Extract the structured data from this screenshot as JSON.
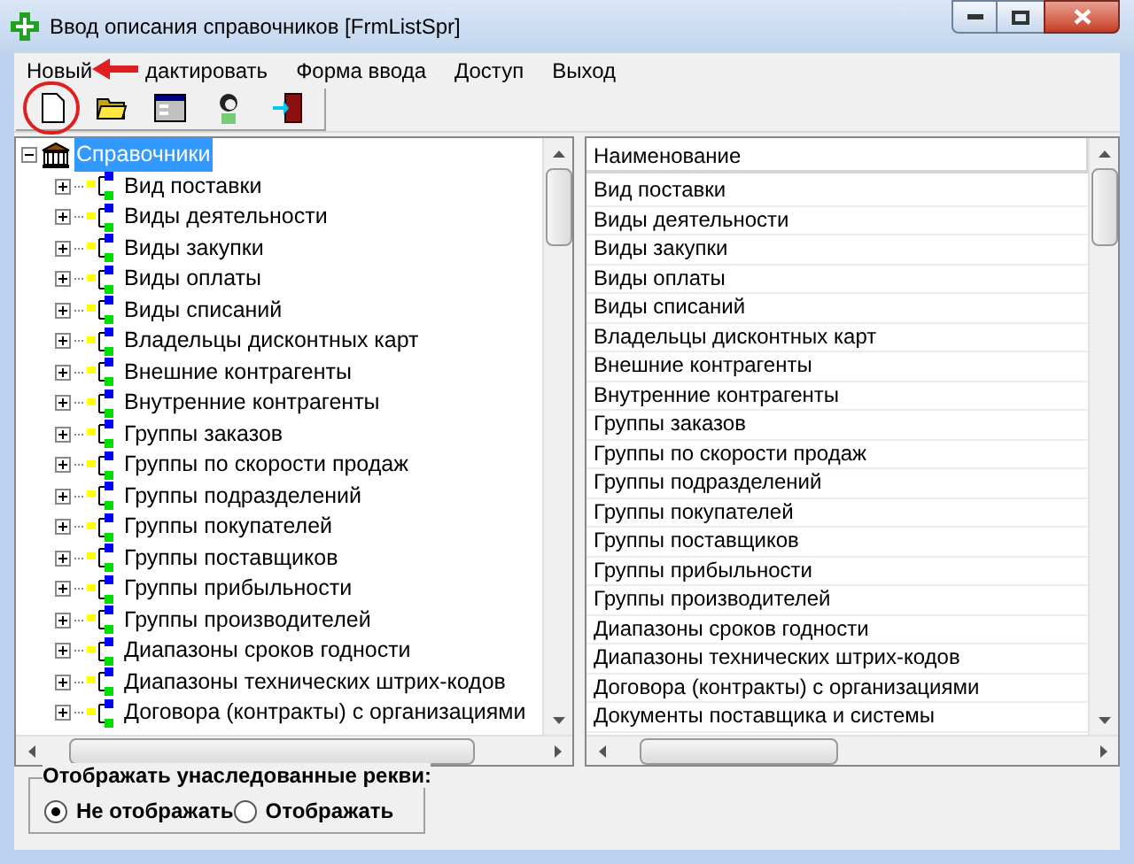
{
  "window": {
    "title": "Ввод описания справочников [FrmListSpr]"
  },
  "menu": [
    {
      "label": "Новый"
    },
    {
      "label": "дактировать"
    },
    {
      "label": "Форма ввода"
    },
    {
      "label": "Доступ"
    },
    {
      "label": "Выход"
    }
  ],
  "toolbar": [
    {
      "kind": "new",
      "circled": true
    },
    {
      "kind": "open",
      "circled": false
    },
    {
      "kind": "form",
      "circled": false
    },
    {
      "kind": "user",
      "circled": false
    },
    {
      "kind": "exit",
      "circled": false
    }
  ],
  "tree": {
    "root": {
      "label": "Справочники",
      "selected": true,
      "expanded": true,
      "children": [
        {
          "label": "Вид поставки"
        },
        {
          "label": "Виды деятельности"
        },
        {
          "label": "Виды закупки"
        },
        {
          "label": "Виды оплаты"
        },
        {
          "label": "Виды списаний"
        },
        {
          "label": "Владельцы дисконтных карт"
        },
        {
          "label": "Внешние контрагенты"
        },
        {
          "label": "Внутренние контрагенты"
        },
        {
          "label": "Группы заказов"
        },
        {
          "label": "Группы по скорости продаж"
        },
        {
          "label": "Группы подразделений"
        },
        {
          "label": "Группы покупателей"
        },
        {
          "label": "Группы поставщиков"
        },
        {
          "label": "Группы прибыльности"
        },
        {
          "label": "Группы производителей"
        },
        {
          "label": "Диапазоны сроков годности"
        },
        {
          "label": "Диапазоны технических штрих-кодов"
        },
        {
          "label": "Договора (контракты) с организациями"
        }
      ]
    }
  },
  "list": {
    "columns": [
      "Наименование"
    ],
    "rows": [
      "Вид поставки",
      "Виды деятельности",
      "Виды закупки",
      "Виды оплаты",
      "Виды списаний",
      "Владельцы дисконтных карт",
      "Внешние контрагенты",
      "Внутренние контрагенты",
      "Группы заказов",
      "Группы по скорости продаж",
      "Группы подразделений",
      "Группы покупателей",
      "Группы поставщиков",
      "Группы прибыльности",
      "Группы производителей",
      "Диапазоны сроков годности",
      "Диапазоны технических штрих-кодов",
      "Договора (контракты) с организациями",
      "Документы поставщика и системы"
    ]
  },
  "inherited": {
    "title": "Отображать унаследованные рекви:",
    "options": [
      {
        "label": "Не отображать",
        "selected": true
      },
      {
        "label": "Отображать",
        "selected": false
      }
    ]
  }
}
